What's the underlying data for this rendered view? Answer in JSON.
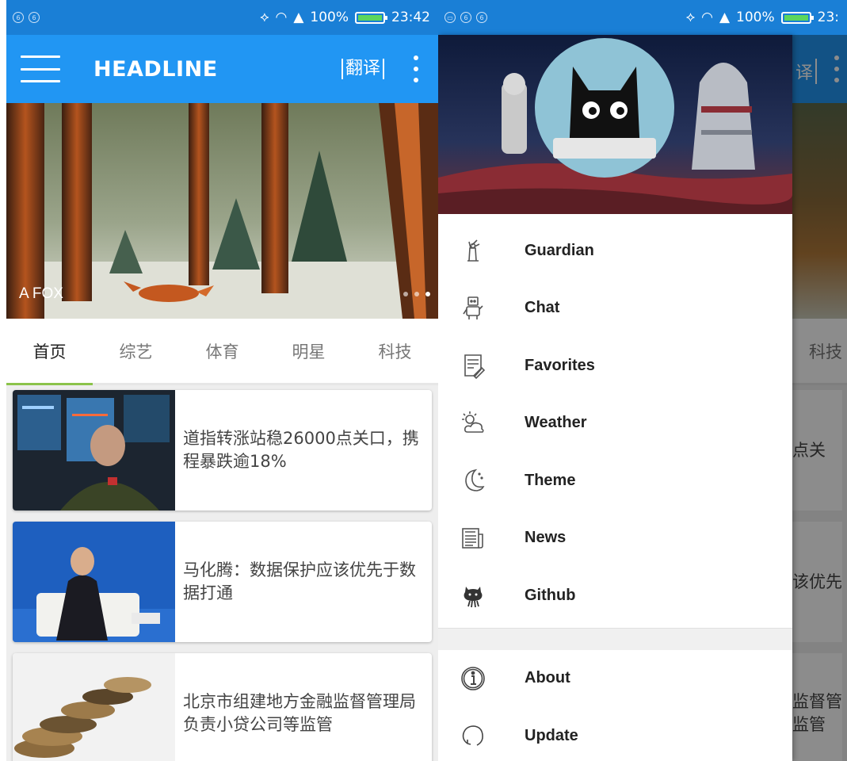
{
  "left": {
    "status": {
      "battery": "100%",
      "time": "23:42"
    },
    "appbar": {
      "title": "HEADLINE",
      "translate": "翻译"
    },
    "banner": {
      "caption": "A FOX"
    },
    "tabs": [
      {
        "label": "首页"
      },
      {
        "label": "综艺"
      },
      {
        "label": "体育"
      },
      {
        "label": "明星"
      },
      {
        "label": "科技"
      }
    ],
    "news": [
      {
        "title": "道指转涨站稳26000点关口，携程暴跌逾18%"
      },
      {
        "title": "马化腾：数据保护应该优先于数据打通"
      },
      {
        "title": "北京市组建地方金融监督管理局 负责小贷公司等监管"
      }
    ]
  },
  "right": {
    "status": {
      "battery": "100%",
      "time": "23:"
    },
    "background": {
      "translate": "译",
      "tab": "科技",
      "snippets": [
        "点关",
        "该优先",
        "监督管\n监管"
      ]
    },
    "menu": [
      {
        "label": "Guardian",
        "icon": "liberty-icon"
      },
      {
        "label": "Chat",
        "icon": "robot-icon"
      },
      {
        "label": "Favorites",
        "icon": "note-pencil-icon"
      },
      {
        "label": "Weather",
        "icon": "sun-cloud-icon"
      },
      {
        "label": "Theme",
        "icon": "moon-icon"
      },
      {
        "label": "News",
        "icon": "newspaper-icon"
      },
      {
        "label": "Github",
        "icon": "octocat-icon"
      }
    ],
    "menu_secondary": [
      {
        "label": "About",
        "icon": "info-icon"
      },
      {
        "label": "Update",
        "icon": "refresh-icon"
      }
    ]
  },
  "colors": {
    "primary": "#2196f3",
    "status_bar": "#1a7fd6",
    "tab_indicator": "#8bc34a"
  }
}
